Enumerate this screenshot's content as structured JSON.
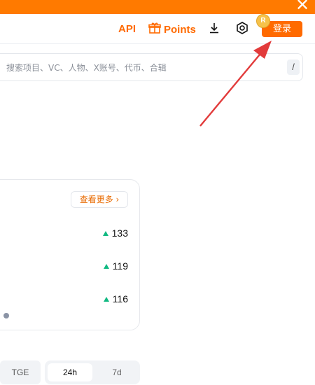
{
  "header": {
    "api_label": "API",
    "points_label": "Points",
    "login_label": "登录",
    "coin_badge": "R"
  },
  "search": {
    "placeholder": "搜索项目、VC、人物、X账号、代币、合辑",
    "shortcut": "/"
  },
  "card": {
    "more_label": "查看更多 ›",
    "rows": [
      {
        "value": "133"
      },
      {
        "value": "119"
      },
      {
        "value": "116"
      }
    ]
  },
  "filters": {
    "tge_label": "TGE",
    "range_options": [
      "24h",
      "7d"
    ],
    "range_selected": "24h"
  },
  "icons": {
    "close": "close-icon",
    "gift": "gift-icon",
    "download": "download-icon",
    "settings": "settings-icon",
    "up_arrow": "up-triangle-icon"
  },
  "colors": {
    "brand_orange": "#ff6a00",
    "up_green": "#10b981",
    "annotation_red": "#e23b3b"
  }
}
